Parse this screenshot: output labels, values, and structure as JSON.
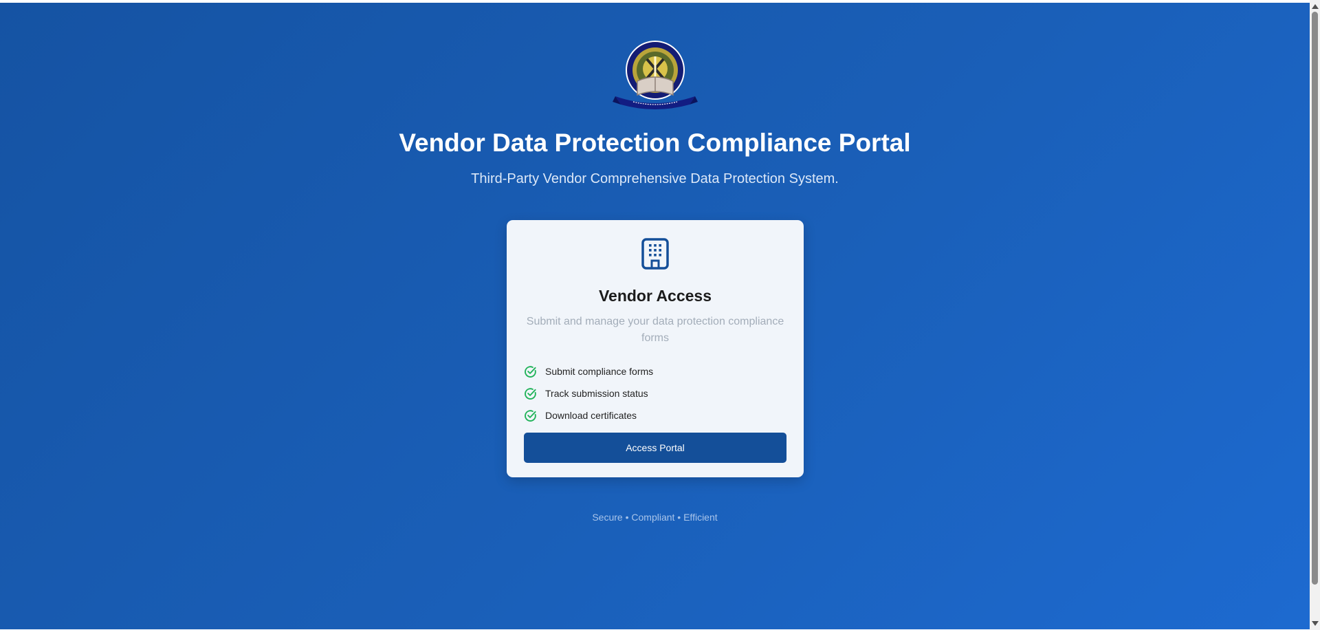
{
  "header": {
    "logo_icon": "redeemers-university-crest-icon",
    "title": "Vendor Data Protection Compliance Portal",
    "subtitle": "Third-Party Vendor Comprehensive Data Protection System."
  },
  "card": {
    "icon": "building-icon",
    "title": "Vendor Access",
    "description": "Submit and manage your data protection compliance forms",
    "features": [
      {
        "icon": "check-circle-icon",
        "label": "Submit compliance forms"
      },
      {
        "icon": "check-circle-icon",
        "label": "Track submission status"
      },
      {
        "icon": "check-circle-icon",
        "label": "Download certificates"
      }
    ],
    "button_label": "Access Portal"
  },
  "footer": {
    "tagline": "Secure • Compliant • Efficient"
  },
  "colors": {
    "background": "#1a5fb8",
    "card_background": "#f1f5fa",
    "button": "#144f99",
    "icon_blue": "#144f99",
    "check_green": "#22b35a"
  }
}
